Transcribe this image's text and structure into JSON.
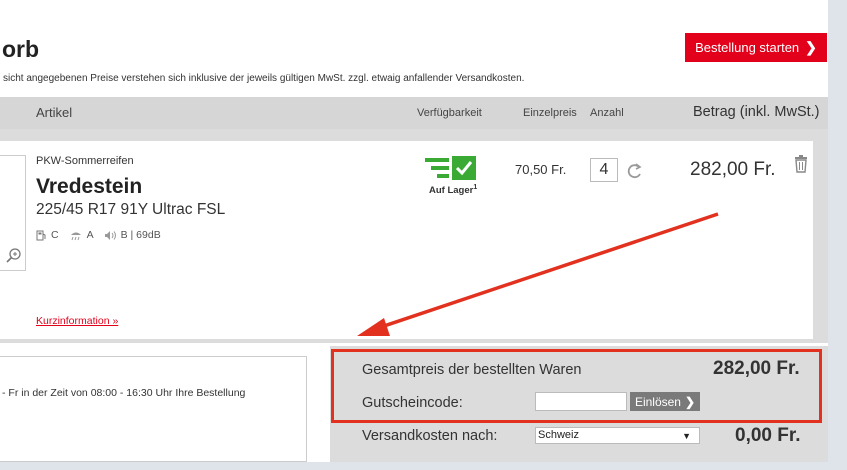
{
  "header": {
    "title": "orb",
    "start_button": "Bestellung starten",
    "note": "sicht angegebenen Preise verstehen sich inklusive der jeweils gültigen MwSt. zzgl. etwaig anfallender Versandkosten."
  },
  "table": {
    "col_article": "Artikel",
    "col_availability": "Verfügbarkeit",
    "col_unit_price": "Einzelpreis",
    "col_quantity": "Anzahl",
    "col_amount": "Betrag (inkl. MwSt.)"
  },
  "item": {
    "category": "PKW-Sommerreifen",
    "brand": "Vredestein",
    "model": "225/45 R17 91Y Ultrac FSL",
    "label_fuel": "C",
    "label_wet": "A",
    "label_noise": "B | 69dB",
    "stock": "Auf Lager",
    "stock_footnote": "1",
    "unit_price": "70,50 Fr.",
    "quantity": "4",
    "total": "282,00 Fr.",
    "short_info_link": "Kurzinformation »"
  },
  "info": {
    "text": "- Fr in der Zeit von 08:00 - 16:30 Uhr Ihre Bestellung"
  },
  "summary": {
    "goods_total_label": "Gesamtpreis der bestellten Waren",
    "goods_total_value": "282,00 Fr.",
    "voucher_label": "Gutscheincode:",
    "voucher_value": "",
    "redeem_button": "Einlösen",
    "shipping_label": "Versandkosten nach:",
    "shipping_country": "Schweiz",
    "shipping_value": "0,00 Fr."
  },
  "colors": {
    "accent_red": "#e2001a",
    "stock_green": "#3aaa35",
    "annotation_red": "#e2321f"
  }
}
